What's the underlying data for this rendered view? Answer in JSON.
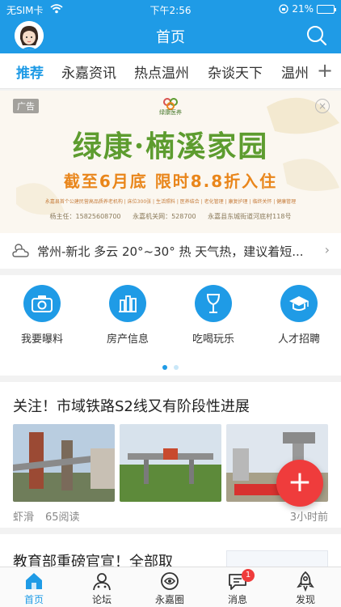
{
  "status_bar": {
    "carrier": "无SIM卡",
    "time": "下午2:56",
    "battery_percent": "21%",
    "battery_fraction": 0.21
  },
  "header": {
    "title": "首页"
  },
  "tabs": [
    {
      "label": "推荐",
      "active": true
    },
    {
      "label": "永嘉资讯",
      "active": false
    },
    {
      "label": "热点温州",
      "active": false
    },
    {
      "label": "杂谈天下",
      "active": false
    },
    {
      "label": "温州",
      "active": false
    }
  ],
  "ad": {
    "tag": "广告",
    "brand": "绿康医养",
    "headline": "绿康·楠溪家园",
    "offer": "截至6月底  限时8.8折入住",
    "services": "永嘉县首个公建民营高品质养老机构 | 床位300张 | 生活照料 | 医养结合 | 老化管理 | 康复护理 | 临终关怀 | 健康管理",
    "contacts": [
      "杨主任：15825608700",
      "永嘉机关网：528700",
      "永嘉县东城街道河底村118号"
    ]
  },
  "weather": {
    "text": "常州-新北  多云  20°~30°  热  天气热，建议着短..."
  },
  "shortcuts": [
    {
      "label": "我要曝料",
      "icon": "camera-icon"
    },
    {
      "label": "房产信息",
      "icon": "building-icon"
    },
    {
      "label": "吃喝玩乐",
      "icon": "drink-icon"
    },
    {
      "label": "人才招聘",
      "icon": "graduation-cap-icon"
    }
  ],
  "carousel": {
    "pages": 2,
    "current": 1
  },
  "articles": [
    {
      "title": "关注！市域铁路S2线又有阶段性进展",
      "author": "虾滑",
      "reads": "65阅读",
      "time": "3小时前"
    },
    {
      "title": "教育部重磅官宣！全部取"
    }
  ],
  "bottom_nav": [
    {
      "label": "首页",
      "icon": "home-icon",
      "active": true
    },
    {
      "label": "论坛",
      "icon": "forum-icon",
      "active": false
    },
    {
      "label": "永嘉圈",
      "icon": "circle-icon",
      "active": false
    },
    {
      "label": "消息",
      "icon": "message-icon",
      "active": false,
      "badge": "1"
    },
    {
      "label": "发现",
      "icon": "rocket-icon",
      "active": false
    }
  ],
  "colors": {
    "brand": "#1f9be6",
    "fab": "#ef3c3c",
    "ad_green": "#5d9c2f",
    "ad_orange": "#e9861b"
  }
}
